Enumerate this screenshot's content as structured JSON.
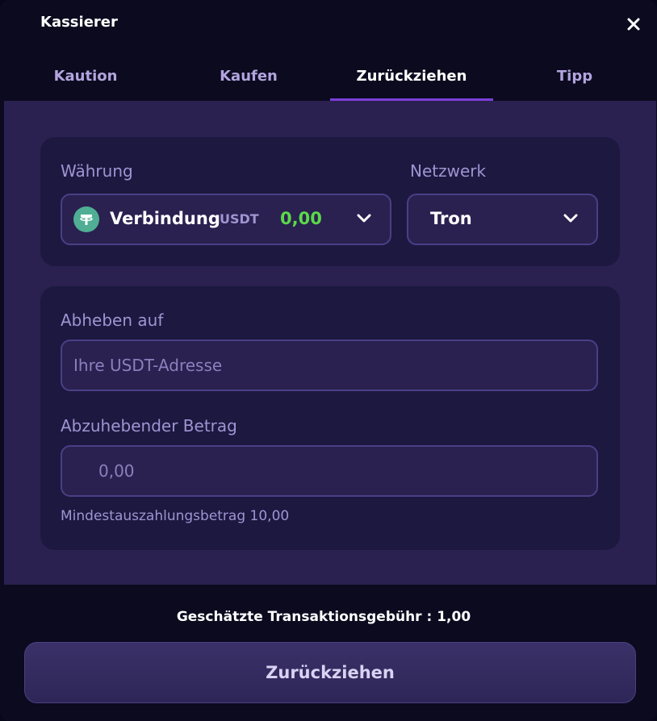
{
  "header": {
    "title": "Kassierer",
    "close_icon": "close-icon"
  },
  "tabs": [
    {
      "label": "Kaution",
      "active": false
    },
    {
      "label": "Kaufen",
      "active": false
    },
    {
      "label": "Zurückziehen",
      "active": true
    },
    {
      "label": "Tipp",
      "active": false
    }
  ],
  "currency": {
    "label": "Währung",
    "name": "Verbindung",
    "code": "USDT",
    "balance": "0,00",
    "icon": "tether-icon"
  },
  "network": {
    "label": "Netzwerk",
    "value": "Tron"
  },
  "withdraw": {
    "address_label": "Abheben auf",
    "address_placeholder": "Ihre USDT-Adresse",
    "amount_label": "Abzuhebender Betrag",
    "amount_placeholder": "0,00",
    "min_note": "Mindestauszahlungsbetrag 10,00"
  },
  "fee_text": "Geschätzte Transaktionsgebühr : 1,00",
  "submit_label": "Zurückziehen",
  "colors": {
    "accent": "#7c3fd9",
    "balance": "#5bd94a",
    "tether": "#4fae93"
  }
}
